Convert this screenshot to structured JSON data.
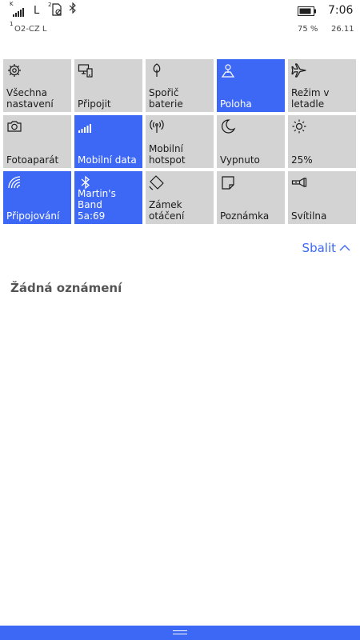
{
  "status": {
    "signal_superscript": "K",
    "network_type": "L",
    "sim2_superscript": "2",
    "sim1_superscript": "1",
    "carrier": "O2-CZ L",
    "time": "7:06",
    "battery_percent": "75 %",
    "date": "26.11"
  },
  "tiles": [
    {
      "label": "Všechna\nnastavení",
      "icon": "gear-icon",
      "active": false
    },
    {
      "label": "Připojit",
      "icon": "connect-icon",
      "active": false
    },
    {
      "label": "Spořič baterie",
      "icon": "battery-saver-icon",
      "active": false
    },
    {
      "label": "Poloha",
      "icon": "location-icon",
      "active": true
    },
    {
      "label": "Režim v\nletadle",
      "icon": "airplane-icon",
      "active": false
    },
    {
      "label": "Fotoaparát",
      "icon": "camera-icon",
      "active": false
    },
    {
      "label": "Mobilní data",
      "icon": "cellular-data-icon",
      "active": true
    },
    {
      "label": "Mobilní\nhotspot",
      "icon": "hotspot-icon",
      "active": false
    },
    {
      "label": "Vypnuto",
      "icon": "quiet-hours-moon-icon",
      "active": false
    },
    {
      "label": "25%",
      "icon": "brightness-icon",
      "active": false
    },
    {
      "label": "Připojování",
      "icon": "wifi-icon",
      "active": true
    },
    {
      "label": "Martin's Band\n5a:69",
      "icon": "bluetooth-icon",
      "active": true
    },
    {
      "label": "Zámek\notáčení",
      "icon": "rotation-lock-icon",
      "active": false
    },
    {
      "label": "Poznámka",
      "icon": "note-icon",
      "active": false
    },
    {
      "label": "Svítilna",
      "icon": "flashlight-icon",
      "active": false
    }
  ],
  "collapse_label": "Sbalit",
  "notifications": {
    "empty_text": "Žádná oznámení"
  },
  "colors": {
    "accent": "#3d68f5",
    "tile_off": "#d3d3d3"
  }
}
